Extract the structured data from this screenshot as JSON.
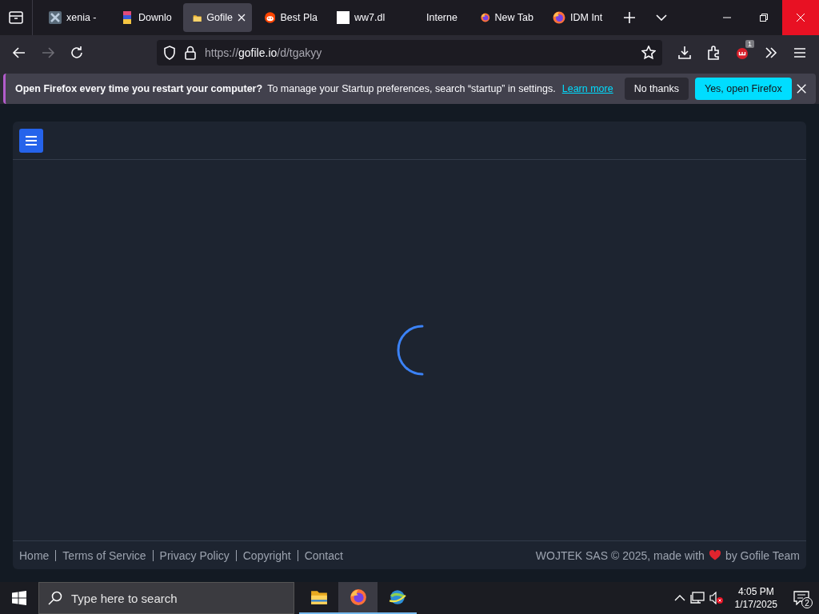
{
  "tabs": [
    {
      "title": "xenia -",
      "kind": "cross",
      "selected": false
    },
    {
      "title": "Downlo",
      "kind": "stack",
      "selected": false
    },
    {
      "title": "Gofile",
      "kind": "folder",
      "selected": true
    },
    {
      "title": "Best Pla",
      "kind": "reddit",
      "selected": false
    },
    {
      "title": "ww7.dl",
      "kind": "blank",
      "selected": false
    },
    {
      "title": "Interne",
      "kind": "none",
      "selected": false
    },
    {
      "title": "New Tab",
      "kind": "firefox",
      "selected": false
    },
    {
      "title": "IDM Int",
      "kind": "firefox",
      "selected": false
    }
  ],
  "address_bar": {
    "scheme": "https://",
    "host": "gofile.io",
    "path": "/d/tgakyy"
  },
  "extension_badge": "1",
  "notification": {
    "bold_text": "Open Firefox every time you restart your computer?",
    "text": "To manage your Startup preferences, search “startup” in settings.",
    "link": "Learn more",
    "buttons": [
      {
        "label": "No thanks",
        "kind": "secondary"
      },
      {
        "label": "Yes, open Firefox",
        "kind": "primary"
      }
    ]
  },
  "footer": {
    "links": [
      "Home",
      "Terms of Service",
      "Privacy Policy",
      "Copyright",
      "Contact"
    ],
    "credit_before": "WOJTEK SAS © 2025, made with",
    "credit_after": "by Gofile Team"
  },
  "taskbar": {
    "search": {
      "placeholder": "Type here to search"
    },
    "apps": [
      {
        "kind": "folder",
        "selected": false
      },
      {
        "kind": "firefox",
        "selected": true
      },
      {
        "kind": "globe",
        "selected": false
      }
    ],
    "time": "4:05 PM",
    "date": "1/17/2025",
    "notifications": "2"
  }
}
